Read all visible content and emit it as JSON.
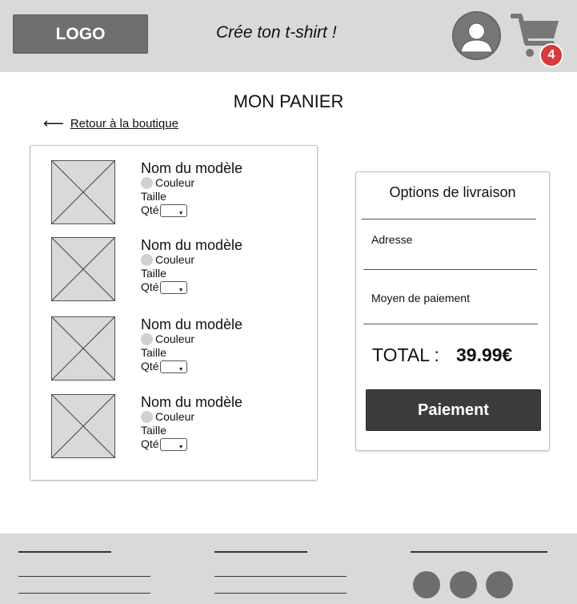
{
  "header": {
    "logo_label": "LOGO",
    "tagline": "Crée ton t-shirt !",
    "profile_icon": "user-avatar-icon",
    "cart_icon": "shopping-cart-icon",
    "cart_count": "4",
    "badge_color": "#d83a3a"
  },
  "main": {
    "title": "MON PANIER",
    "back_arrow": "⟵",
    "back_label": "Retour à la boutique"
  },
  "cart_items": [
    {
      "name": "Nom du modèle",
      "color_label": "Couleur",
      "size_label": "Taille",
      "qty_label": "Qté"
    },
    {
      "name": "Nom du modèle",
      "color_label": "Couleur",
      "size_label": "Taille",
      "qty_label": "Qté"
    },
    {
      "name": "Nom du modèle",
      "color_label": "Couleur",
      "size_label": "Taille",
      "qty_label": "Qté"
    },
    {
      "name": "Nom du modèle",
      "color_label": "Couleur",
      "size_label": "Taille",
      "qty_label": "Qté"
    }
  ],
  "delivery": {
    "title": "Options de livraison",
    "address_label": "Adresse",
    "payment_method_label": "Moyen de paiement",
    "total_label": "TOTAL :",
    "total_value": "39.99€",
    "pay_button": "Paiement"
  },
  "colors": {
    "header_bg": "#d9d9d9",
    "button_dark": "#3c3c3c",
    "logo_bg": "#6f6f6f"
  }
}
